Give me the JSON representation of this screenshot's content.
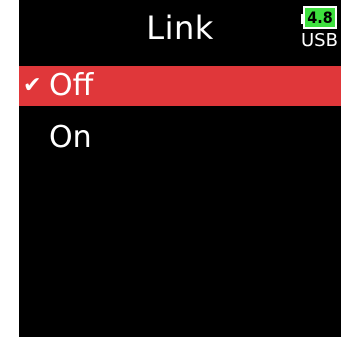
{
  "header": {
    "title": "Link"
  },
  "status": {
    "battery_voltage": "4.8",
    "power_source": "USB",
    "battery_color": "#3ee03e"
  },
  "menu": {
    "items": [
      {
        "label": "Off",
        "checked": true,
        "selected": true
      },
      {
        "label": "On",
        "checked": false,
        "selected": false
      }
    ],
    "check_glyph": "✔",
    "highlight_color": "#e0373a"
  }
}
